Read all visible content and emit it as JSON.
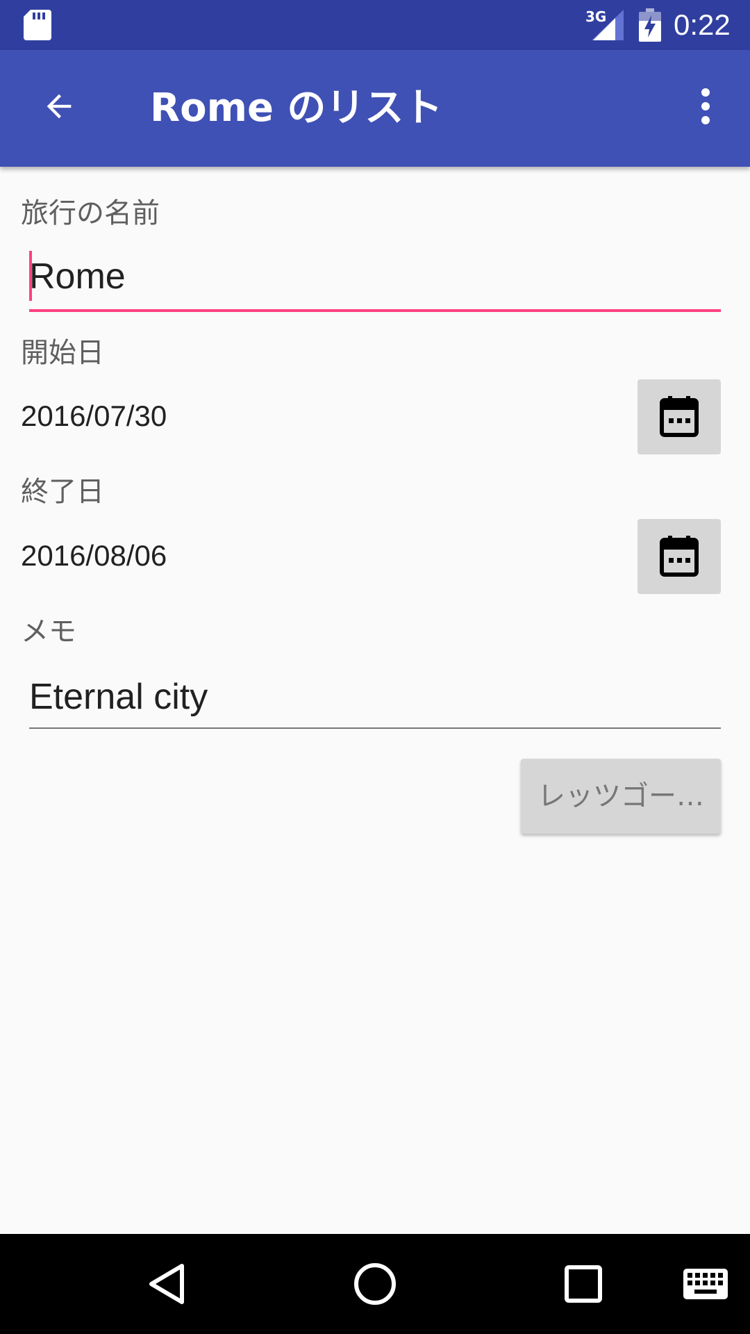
{
  "status_bar": {
    "time": "0:22",
    "network": "3G",
    "icons": [
      "sd-card-icon",
      "signal-icon",
      "battery-charging-icon"
    ]
  },
  "app_bar": {
    "title": "Rome のリスト",
    "back_icon": "arrow-back-icon",
    "menu_icon": "more-vert-icon",
    "color": "#3f51b5"
  },
  "form": {
    "trip_name": {
      "label": "旅行の名前",
      "value": "Rome"
    },
    "start_date": {
      "label": "開始日",
      "value": "2016/07/30",
      "icon": "calendar-icon"
    },
    "end_date": {
      "label": "終了日",
      "value": "2016/08/06",
      "icon": "calendar-icon"
    },
    "memo": {
      "label": "メモ",
      "value": "Eternal city"
    },
    "go_button": "レッツゴー…"
  },
  "nav_bar": {
    "icons": [
      "back-triangle-icon",
      "home-circle-icon",
      "recents-square-icon",
      "keyboard-icon"
    ]
  },
  "colors": {
    "status_bar": "#303f9f",
    "accent": "#ff4081",
    "background": "#fafafa"
  }
}
